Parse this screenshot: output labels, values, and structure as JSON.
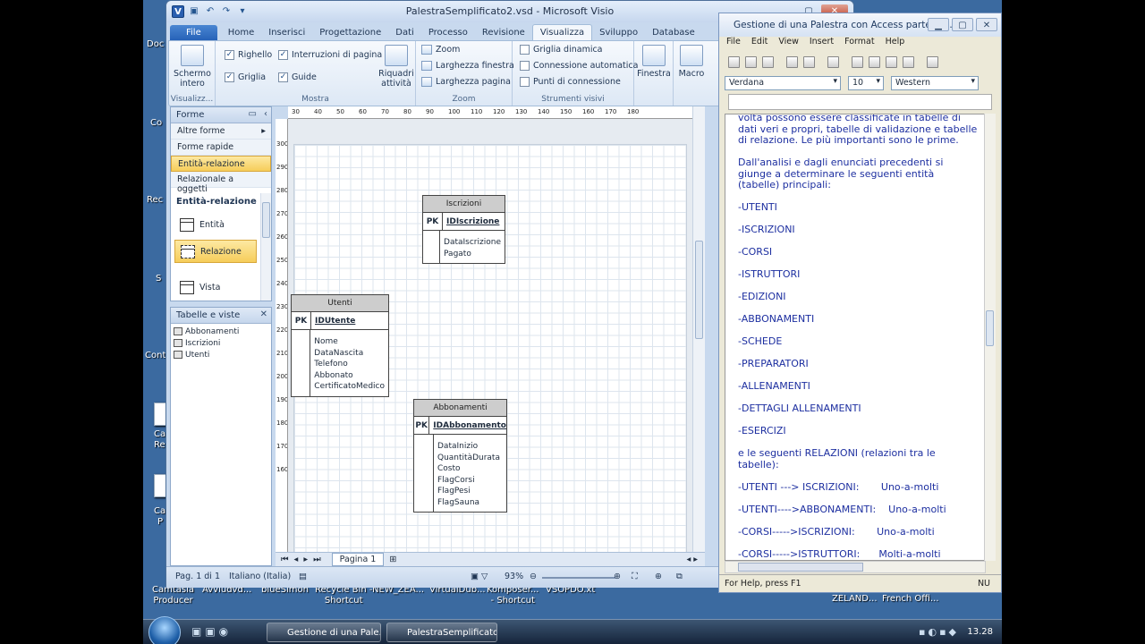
{
  "visio": {
    "title": "PalestraSemplificato2.vsd  -  Microsoft Visio",
    "tabs": [
      "File",
      "Home",
      "Inserisci",
      "Progettazione",
      "Dati",
      "Processo",
      "Revisione",
      "Visualizza",
      "Sviluppo",
      "Database"
    ],
    "active_tab": "Visualizza",
    "ribbon": {
      "full_screen": "Schermo\nintero",
      "group_views": "Visualizz...",
      "show": {
        "ruler": "Righello",
        "page_breaks": "Interruzioni di pagina",
        "grid": "Griglia",
        "guides": "Guide"
      },
      "task_panes": "Riquadri\nattività",
      "group_show": "Mostra",
      "zoom": "Zoom",
      "fit_width": "Larghezza finestra",
      "page_width": "Larghezza pagina",
      "group_zoom": "Zoom",
      "dynamic_grid": "Griglia dinamica",
      "auto_connect": "Connessione automatica",
      "connection_points": "Punti di connessione",
      "group_visual": "Strumenti visivi",
      "window": "Finestra",
      "macro": "Macro"
    },
    "shapes_pane": {
      "title": "Forme",
      "items": [
        "Altre forme",
        "Forme rapide",
        "Entità-relazione",
        "Relazionale a oggetti"
      ],
      "stencil_title": "Entità-relazione",
      "stencil_shapes": [
        "Entità",
        "Relazione",
        "Vista"
      ]
    },
    "tables_pane": {
      "title": "Tabelle e viste",
      "items": [
        "Abbonamenti",
        "Iscrizioni",
        "Utenti"
      ]
    },
    "entities": [
      {
        "name": "Iscrizioni",
        "pk": "IDIscrizione",
        "fields": [
          "DataIscrizione",
          "Pagato"
        ]
      },
      {
        "name": "Utenti",
        "pk": "IDUtente",
        "fields": [
          "Nome",
          "DataNascita",
          "Telefono",
          "Abbonato",
          "CertificatoMedico"
        ]
      },
      {
        "name": "Abbonamenti",
        "pk": "IDAbbonamento",
        "fields": [
          "DataInizio",
          "QuantitàDurata",
          "Costo",
          "FlagCorsi",
          "FlagPesi",
          "FlagSauna"
        ]
      }
    ],
    "pk_label": "PK",
    "ruler_top": [
      "30",
      "40",
      "50",
      "60",
      "70",
      "80",
      "90",
      "100",
      "110",
      "120",
      "130",
      "140",
      "150",
      "160",
      "170",
      "180"
    ],
    "ruler_left": [
      "300",
      "290",
      "280",
      "270",
      "260",
      "250",
      "240",
      "230",
      "220",
      "210",
      "200",
      "190",
      "180",
      "170",
      "160"
    ],
    "page_tab": "Pagina 1",
    "status": {
      "page": "Pag. 1 di 1",
      "language": "Italiano (Italia)",
      "zoom": "93%"
    }
  },
  "word": {
    "title": "Gestione di una Palestra con Access parte pri...",
    "menu": [
      "File",
      "Edit",
      "View",
      "Insert",
      "Format",
      "Help"
    ],
    "font": "Verdana",
    "size": "10",
    "script": "Western",
    "paragraphs": [
      "volta possono essere classificate in tabelle di dati veri e propri, tabelle di validazione e tabelle di relazione. Le più importanti sono le prime.",
      "Dall'analisi e dagli enunciati precedenti si giunge a determinare le seguenti entità (tabelle) principali:",
      "-UTENTI",
      "-ISCRIZIONI",
      "-CORSI",
      "-ISTRUTTORI",
      "-EDIZIONI",
      "-ABBONAMENTI",
      "-SCHEDE",
      "-PREPARATORI",
      "-ALLENAMENTI",
      "-DETTAGLI ALLENAMENTI",
      "-ESERCIZI",
      "e le seguenti RELAZIONI (relazioni tra le tabelle):",
      "-UTENTI ---> ISCRIZIONI:       Uno-a-molti",
      "-UTENTI---->ABBONAMENTI:    Uno-a-molti",
      "-CORSI----->ISCRIZIONI:       Uno-a-molti",
      "-CORSI----->ISTRUTTORI:      Molti-a-molti\n(entità di raccordo: EDIZIONI)"
    ],
    "status_help": "For Help, press F1",
    "status_num": "NU"
  },
  "desktop": {
    "labels": [
      "Doc",
      "Co",
      "Rec",
      "S",
      "Cont",
      "Ca",
      "Re",
      "Ca",
      "P",
      "Camtasia\nProducer",
      "Avviudvd...",
      "blueSimon",
      "Recycle Bin -\nShortcut",
      "NEW_ZEA...",
      "VirtualDub...",
      "Komposer...\n- Shortcut",
      "VSOPDO.xt",
      "ZELAND...",
      "French Offi..."
    ]
  },
  "taskbar": {
    "buttons": [
      "Gestione di una Pale...",
      "PalestraSemplificato..."
    ],
    "clock": "13.28"
  }
}
